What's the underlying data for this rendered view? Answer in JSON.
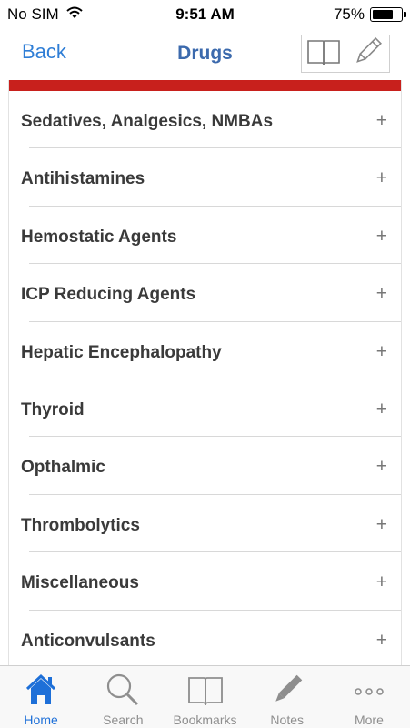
{
  "status_bar": {
    "carrier": "No SIM",
    "time": "9:51 AM",
    "battery_percent_label": "75%",
    "battery_level": 0.75
  },
  "nav": {
    "back_label": "Back",
    "title": "Drugs",
    "actions": [
      {
        "icon": "book-icon"
      },
      {
        "icon": "pencil-icon"
      }
    ]
  },
  "colors": {
    "accent_blue": "#2f7ed6",
    "title_blue": "#3c6aad",
    "banner_red": "#c8201c"
  },
  "list": {
    "items": [
      {
        "label": "Sedatives, Analgesics, NMBAs",
        "expand": "+"
      },
      {
        "label": "Antihistamines",
        "expand": "+"
      },
      {
        "label": "Hemostatic Agents",
        "expand": "+"
      },
      {
        "label": "ICP Reducing Agents",
        "expand": "+"
      },
      {
        "label": "Hepatic Encephalopathy",
        "expand": "+"
      },
      {
        "label": "Thyroid",
        "expand": "+"
      },
      {
        "label": "Opthalmic",
        "expand": "+"
      },
      {
        "label": "Thrombolytics",
        "expand": "+"
      },
      {
        "label": "Miscellaneous",
        "expand": "+"
      },
      {
        "label": "Anticonvulsants",
        "expand": "+"
      }
    ]
  },
  "tab_bar": {
    "tabs": [
      {
        "label": "Home",
        "icon": "home-icon",
        "active": true
      },
      {
        "label": "Search",
        "icon": "search-icon",
        "active": false
      },
      {
        "label": "Bookmarks",
        "icon": "bookmarks-icon",
        "active": false
      },
      {
        "label": "Notes",
        "icon": "notes-icon",
        "active": false
      },
      {
        "label": "More",
        "icon": "more-icon",
        "active": false
      }
    ]
  }
}
